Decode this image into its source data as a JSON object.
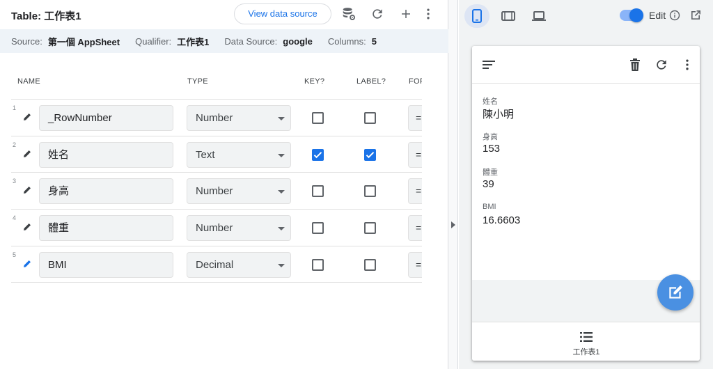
{
  "header": {
    "title": "Table: 工作表1",
    "view_data_source": "View data source",
    "icons": [
      "database-settings-icon",
      "refresh-icon",
      "add-icon",
      "more-vert-icon"
    ]
  },
  "infobar": {
    "source_label": "Source:",
    "source_value": "第一個 AppSheet",
    "qualifier_label": "Qualifier:",
    "qualifier_value": "工作表1",
    "datasource_label": "Data Source:",
    "datasource_value": "google",
    "columns_label": "Columns:",
    "columns_value": "5"
  },
  "columns_header": {
    "name": "NAME",
    "type": "TYPE",
    "key": "KEY?",
    "label": "LABEL?",
    "formula": "FOR"
  },
  "rows": [
    {
      "num": "1",
      "name": "_RowNumber",
      "type": "Number",
      "key": false,
      "label": false,
      "formula": "="
    },
    {
      "num": "2",
      "name": "姓名",
      "type": "Text",
      "key": true,
      "label": true,
      "formula": "="
    },
    {
      "num": "3",
      "name": "身高",
      "type": "Number",
      "key": false,
      "label": false,
      "formula": "="
    },
    {
      "num": "4",
      "name": "體重",
      "type": "Number",
      "key": false,
      "label": false,
      "formula": "="
    },
    {
      "num": "5",
      "name": "BMI",
      "type": "Decimal",
      "key": false,
      "label": false,
      "formula": "="
    }
  ],
  "preview": {
    "edit_label": "Edit",
    "edit_enabled": true,
    "fields": [
      {
        "label": "姓名",
        "value": "陳小明"
      },
      {
        "label": "身高",
        "value": "153"
      },
      {
        "label": "體重",
        "value": "39"
      },
      {
        "label": "BMI",
        "value": "16.6603"
      }
    ],
    "nav_label": "工作表1"
  },
  "colors": {
    "accent": "#1a73e8",
    "fab": "#4a90e2",
    "infobar_bg": "#eef3f8"
  }
}
